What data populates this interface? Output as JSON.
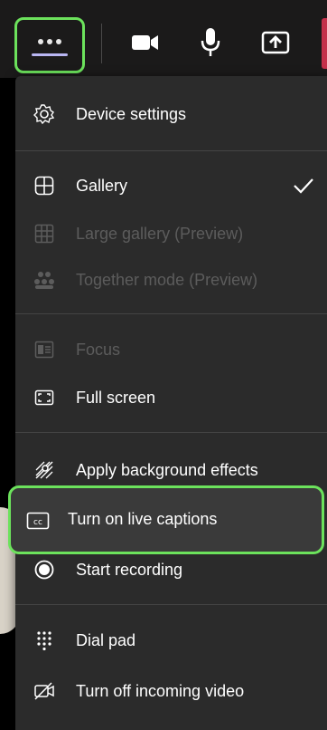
{
  "toolbar": {
    "more_button": "more-options",
    "icons": [
      "camera-icon",
      "microphone-icon",
      "share-screen-icon"
    ],
    "accent_green": "#6ce25c"
  },
  "menu": {
    "device_settings": "Device settings",
    "gallery": "Gallery",
    "large_gallery": "Large gallery (Preview)",
    "together_mode": "Together mode (Preview)",
    "focus": "Focus",
    "full_screen": "Full screen",
    "apply_background": "Apply background effects",
    "live_captions": "Turn on live captions",
    "start_recording": "Start recording",
    "dial_pad": "Dial pad",
    "incoming_video": "Turn off incoming video"
  },
  "colors": {
    "menu_bg": "#2b2b2b",
    "disabled_text": "#5c5c5c",
    "highlight": "#6ce25c"
  }
}
